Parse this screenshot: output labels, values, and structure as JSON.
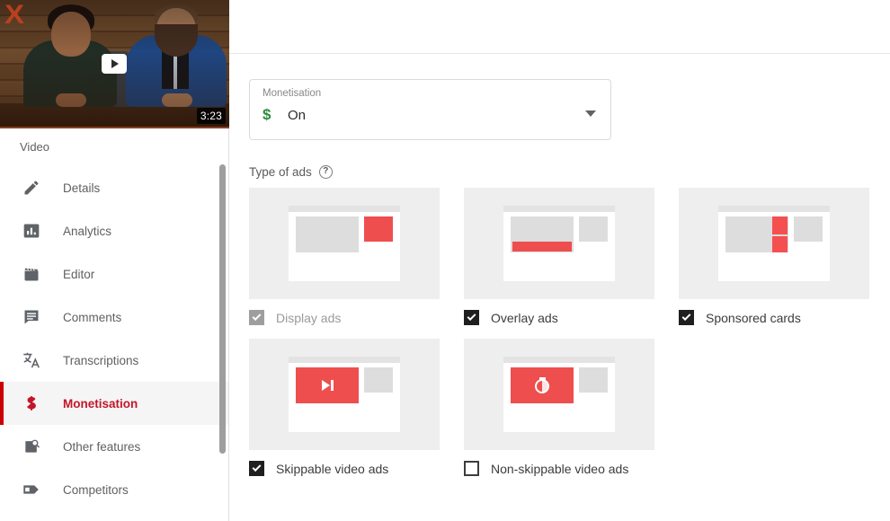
{
  "sidebar": {
    "video_thumbnail": {
      "duration": "3:23",
      "play_button_icon": "play-icon",
      "channel_logo_glyph": "X"
    },
    "section_label": "Video",
    "items": [
      {
        "label": "Details",
        "icon": "pencil-icon",
        "active": false
      },
      {
        "label": "Analytics",
        "icon": "bar-chart-icon",
        "active": false
      },
      {
        "label": "Editor",
        "icon": "clapperboard-icon",
        "active": false
      },
      {
        "label": "Comments",
        "icon": "comment-icon",
        "active": false
      },
      {
        "label": "Transcriptions",
        "icon": "translate-icon",
        "active": false
      },
      {
        "label": "Monetisation",
        "icon": "dollar-icon",
        "active": true
      },
      {
        "label": "Other features",
        "icon": "magnifier-page-icon",
        "active": false
      },
      {
        "label": "Competitors",
        "icon": "play-tag-icon",
        "active": false
      }
    ],
    "scrollbar": {
      "name": "sidebar-scrollbar"
    }
  },
  "main": {
    "monetisation_select": {
      "floating_label": "Monetisation",
      "value": "On",
      "value_icon": "dollar-icon",
      "caret_icon": "chevron-down-icon"
    },
    "type_of_ads": {
      "title": "Type of ads",
      "help_icon": "help-icon",
      "help_glyph": "?"
    },
    "ad_types": [
      {
        "label": "Display ads",
        "checked": true,
        "disabled": true,
        "preview": "display"
      },
      {
        "label": "Overlay ads",
        "checked": true,
        "disabled": false,
        "preview": "overlay"
      },
      {
        "label": "Sponsored cards",
        "checked": true,
        "disabled": false,
        "preview": "cards"
      },
      {
        "label": "Skippable video ads",
        "checked": true,
        "disabled": false,
        "preview": "skippable"
      },
      {
        "label": "Non-skippable video ads",
        "checked": false,
        "disabled": false,
        "preview": "nonskippable"
      }
    ]
  },
  "colors": {
    "accent_red": "#c4162a",
    "active_bar_red": "#cc0000",
    "ad_red": "#EF4E4E",
    "dollar_green": "#2e8b3d",
    "card_grey": "#eeeeee"
  }
}
